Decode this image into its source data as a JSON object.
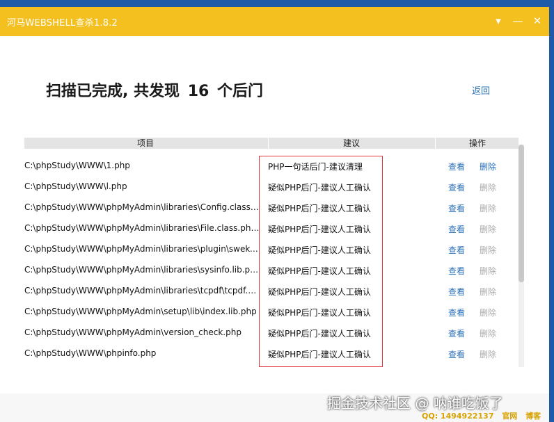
{
  "window": {
    "title": "河马WEBSHELL查杀1.8.2",
    "controls": {
      "menu": "▾",
      "minimize": "—",
      "close": "✕"
    }
  },
  "summary": {
    "prefix": "扫描已完成, 共发现",
    "count": "16",
    "suffix": "个后门"
  },
  "back_label": "返回",
  "table": {
    "columns": {
      "item": "项目",
      "suggestion": "建议",
      "action": "操作"
    },
    "view_label": "查看",
    "delete_label": "删除",
    "rows": [
      {
        "path": "C:\\phpStudy\\WWW\\1.php",
        "suggestion": "PHP一句话后门-建议清理"
      },
      {
        "path": "C:\\phpStudy\\WWW\\l.php",
        "suggestion": "疑似PHP后门-建议人工确认"
      },
      {
        "path": "C:\\phpStudy\\WWW\\phpMyAdmin\\libraries\\Config.class.php...",
        "suggestion": "疑似PHP后门-建议人工确认"
      },
      {
        "path": "C:\\phpStudy\\WWW\\phpMyAdmin\\libraries\\File.class.php...",
        "suggestion": "疑似PHP后门-建议人工确认"
      },
      {
        "path": "C:\\phpStudy\\WWW\\phpMyAdmin\\libraries\\plugin\\swekey\\swekey...",
        "suggestion": "疑似PHP后门-建议人工确认"
      },
      {
        "path": "C:\\phpStudy\\WWW\\phpMyAdmin\\libraries\\sysinfo.lib.php...",
        "suggestion": "疑似PHP后门-建议人工确认"
      },
      {
        "path": "C:\\phpStudy\\WWW\\phpMyAdmin\\libraries\\tcpdf\\tcpdf.php...",
        "suggestion": "疑似PHP后门-建议人工确认"
      },
      {
        "path": "C:\\phpStudy\\WWW\\phpMyAdmin\\setup\\lib\\index.lib.php",
        "suggestion": "疑似PHP后门-建议人工确认"
      },
      {
        "path": "C:\\phpStudy\\WWW\\phpMyAdmin\\version_check.php",
        "suggestion": "疑似PHP后门-建议人工确认"
      },
      {
        "path": "C:\\phpStudy\\WWW\\phpinfo.php",
        "suggestion": "疑似PHP后门-建议人工确认"
      }
    ]
  },
  "status": {
    "qq": "QQ: 1494922137",
    "link1": "官网",
    "link2": "博客"
  },
  "watermark": "掘金技术社区 @ 呐谁吃饭了",
  "colors": {
    "titlebar": "#f4c020",
    "link": "#2a6fb6",
    "highlight_box": "#e0343a"
  }
}
